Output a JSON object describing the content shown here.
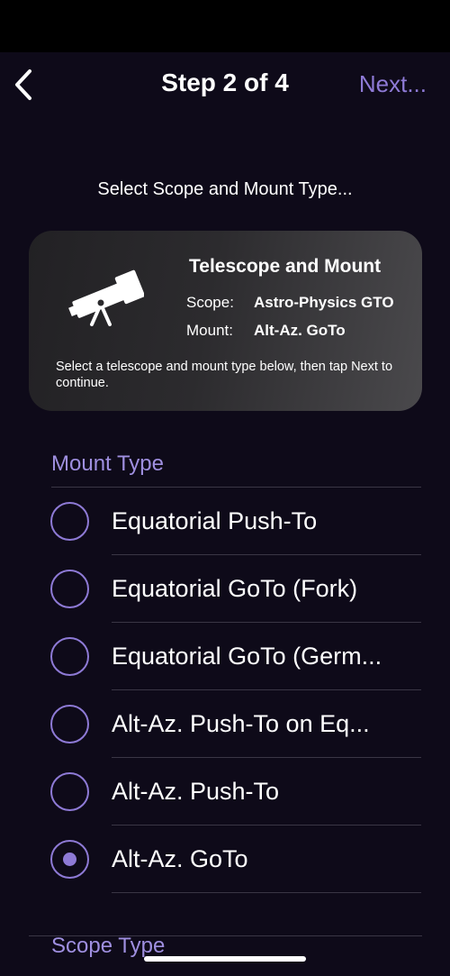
{
  "nav": {
    "title": "Step 2 of 4",
    "next_label": "Next...",
    "back_icon": "chevron-left-icon"
  },
  "instruction": "Select Scope and Mount Type...",
  "summary_card": {
    "icon": "telescope-icon",
    "title": "Telescope and Mount",
    "scope_label": "Scope:",
    "scope_value": "Astro-Physics GTO",
    "mount_label": "Mount:",
    "mount_value": "Alt-Az. GoTo",
    "hint": "Select a telescope and mount type below, then tap Next to continue."
  },
  "mount_type": {
    "header": "Mount Type",
    "options": [
      {
        "label": "Equatorial Push-To",
        "selected": false
      },
      {
        "label": "Equatorial GoTo (Fork)",
        "selected": false
      },
      {
        "label": "Equatorial GoTo (Germ...",
        "selected": false
      },
      {
        "label": "Alt-Az. Push-To on Eq...",
        "selected": false
      },
      {
        "label": "Alt-Az. Push-To",
        "selected": false
      },
      {
        "label": "Alt-Az. GoTo",
        "selected": true
      }
    ]
  },
  "scope_type": {
    "header": "Scope Type"
  },
  "colors": {
    "accent": "#8e7ad6",
    "section_header": "#9f8fe0",
    "background": "#0e0a19"
  }
}
